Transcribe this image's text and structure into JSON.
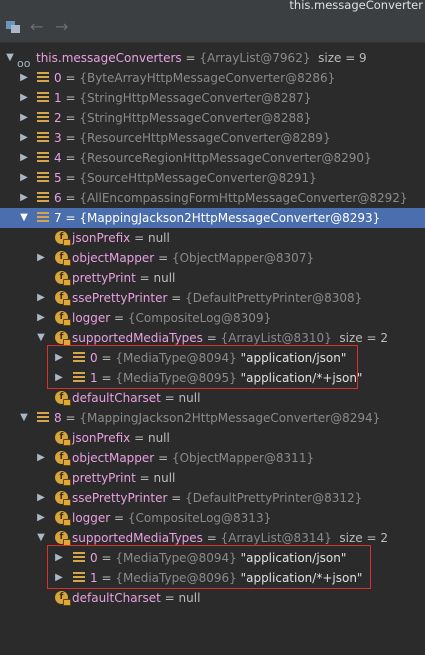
{
  "window": {
    "title": "this.messageConverter"
  },
  "root": {
    "name": "this.messageConverters",
    "value": "{ArrayList@7962}",
    "extra": "size = 9"
  },
  "items": [
    {
      "name": "0",
      "value": "{ByteArrayHttpMessageConverter@8286}"
    },
    {
      "name": "1",
      "value": "{StringHttpMessageConverter@8287}"
    },
    {
      "name": "2",
      "value": "{StringHttpMessageConverter@8288}"
    },
    {
      "name": "3",
      "value": "{ResourceHttpMessageConverter@8289}"
    },
    {
      "name": "4",
      "value": "{ResourceRegionHttpMessageConverter@8290}"
    },
    {
      "name": "5",
      "value": "{SourceHttpMessageConverter@8291}"
    },
    {
      "name": "6",
      "value": "{AllEncompassingFormHttpMessageConverter@8292}"
    },
    {
      "name": "7",
      "value": "{MappingJackson2HttpMessageConverter@8293}"
    },
    {
      "name": "8",
      "value": "{MappingJackson2HttpMessageConverter@8294}"
    }
  ],
  "item7": {
    "jsonPrefix": {
      "name": "jsonPrefix",
      "value": "null"
    },
    "objectMapper": {
      "name": "objectMapper",
      "value": "{ObjectMapper@8307}"
    },
    "prettyPrint": {
      "name": "prettyPrint",
      "value": "null"
    },
    "ssePrettyPrinter": {
      "name": "ssePrettyPrinter",
      "value": "{DefaultPrettyPrinter@8308}"
    },
    "logger": {
      "name": "logger",
      "value": "{CompositeLog@8309}"
    },
    "supportedMediaTypes": {
      "name": "supportedMediaTypes",
      "value": "{ArrayList@8310}",
      "extra": "size = 2"
    },
    "mt0": {
      "name": "0",
      "value": "{MediaType@8094}",
      "str": "\"application/json\""
    },
    "mt1": {
      "name": "1",
      "value": "{MediaType@8095}",
      "str": "\"application/*+json\""
    },
    "defaultCharset": {
      "name": "defaultCharset",
      "value": "null"
    }
  },
  "item8": {
    "jsonPrefix": {
      "name": "jsonPrefix",
      "value": "null"
    },
    "objectMapper": {
      "name": "objectMapper",
      "value": "{ObjectMapper@8311}"
    },
    "prettyPrint": {
      "name": "prettyPrint",
      "value": "null"
    },
    "ssePrettyPrinter": {
      "name": "ssePrettyPrinter",
      "value": "{DefaultPrettyPrinter@8312}"
    },
    "logger": {
      "name": "logger",
      "value": "{CompositeLog@8313}"
    },
    "supportedMediaTypes": {
      "name": "supportedMediaTypes",
      "value": "{ArrayList@8314}",
      "extra": "size = 2"
    },
    "mt0": {
      "name": "0",
      "value": "{MediaType@8094}",
      "str": "\"application/json\""
    },
    "mt1": {
      "name": "1",
      "value": "{MediaType@8096}",
      "str": "\"application/*+json\""
    },
    "defaultCharset": {
      "name": "defaultCharset",
      "value": "null"
    }
  },
  "colors": {
    "background": "#2b2b2b",
    "selection": "#4b6eaf",
    "highlight_box": "#d8312c",
    "field_icon": "#d9a53a"
  },
  "icons": {
    "toolbar": [
      "debugger-icon",
      "back-arrow-icon",
      "forward-arrow-icon"
    ],
    "root": "watch-glasses-icon",
    "array_item": "list-icon",
    "field": "field-f-icon"
  }
}
